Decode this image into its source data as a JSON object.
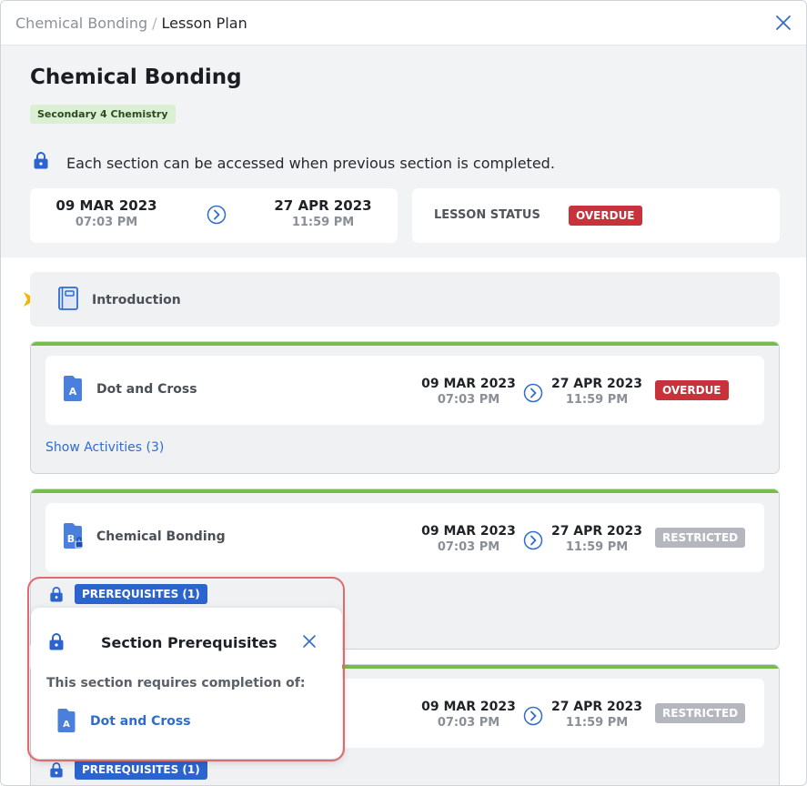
{
  "breadcrumb": {
    "parent": "Chemical Bonding",
    "separator": "/",
    "current": "Lesson Plan"
  },
  "lesson": {
    "title": "Chemical Bonding",
    "tag": "Secondary 4 Chemistry",
    "access_note": "Each section can be accessed when previous section is completed.",
    "start_date": "09 MAR 2023",
    "start_time": "07:03 PM",
    "end_date": "27 APR 2023",
    "end_time": "11:59 PM",
    "status_label": "LESSON STATUS",
    "status": "OVERDUE"
  },
  "introduction": {
    "label": "Introduction"
  },
  "sections": [
    {
      "icon_letter": "A",
      "title": "Dot and Cross",
      "start_date": "09 MAR 2023",
      "start_time": "07:03 PM",
      "end_date": "27 APR 2023",
      "end_time": "11:59 PM",
      "status": "OVERDUE",
      "show_activities": "Show Activities (3)"
    },
    {
      "icon_letter": "B",
      "title": "Chemical Bonding",
      "start_date": "09 MAR 2023",
      "start_time": "07:03 PM",
      "end_date": "27 APR 2023",
      "end_time": "11:59 PM",
      "status": "RESTRICTED",
      "prerequisites": "PREREQUISITES (1)"
    },
    {
      "title": "",
      "start_date": "09 MAR 2023",
      "start_time": "07:03 PM",
      "end_date": "27 APR 2023",
      "end_time": "11:59 PM",
      "status": "RESTRICTED",
      "prerequisites": "PREREQUISITES (1)"
    }
  ],
  "popup": {
    "title": "Section Prerequisites",
    "description": "This section requires completion of:",
    "item_letter": "A",
    "item_label": "Dot and Cross"
  },
  "colors": {
    "accent_blue": "#2f6cd0",
    "overdue_red": "#c8323b",
    "restricted_grey": "#b4b8be",
    "progress_green": "#77bd4c",
    "highlight_red": "#e06a70"
  }
}
